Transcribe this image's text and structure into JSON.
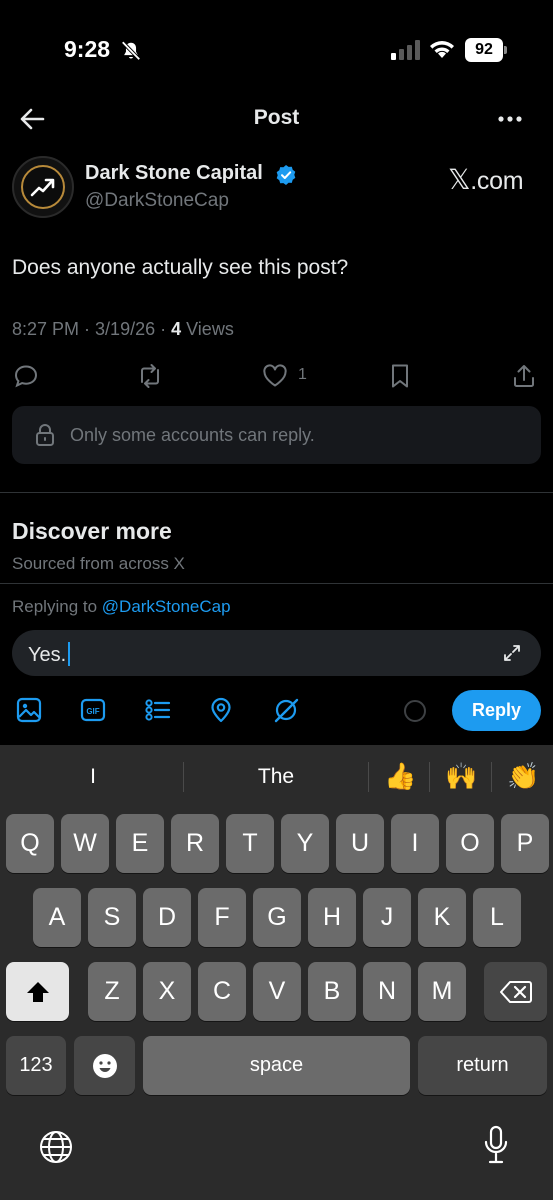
{
  "status_bar": {
    "time": "9:28",
    "battery": "92"
  },
  "header": {
    "title": "Post"
  },
  "author": {
    "name": "Dark Stone Capital",
    "handle": "@DarkStoneCap",
    "brand_x": "𝕏",
    "brand_suffix": ".com"
  },
  "post": {
    "text": "Does anyone actually see this post?",
    "time": "8:27 PM",
    "date": "3/19/26",
    "sep": " · ",
    "views_count": "4",
    "views_label": " Views",
    "like_count": "1"
  },
  "reply_restriction": "Only some accounts can reply.",
  "discover": {
    "title": "Discover more",
    "subtitle": "Sourced from across X"
  },
  "compose": {
    "replying_to_label": "Replying to ",
    "replying_to_handle": "@DarkStoneCap",
    "text": "Yes.",
    "reply_button": "Reply"
  },
  "keyboard": {
    "suggestions": [
      "I",
      "The"
    ],
    "emoji_suggestions": [
      "👍",
      "🙌",
      "👏"
    ],
    "row1": [
      "Q",
      "W",
      "E",
      "R",
      "T",
      "Y",
      "U",
      "I",
      "O",
      "P"
    ],
    "row2": [
      "A",
      "S",
      "D",
      "F",
      "G",
      "H",
      "J",
      "K",
      "L"
    ],
    "row3": [
      "Z",
      "X",
      "C",
      "V",
      "B",
      "N",
      "M"
    ],
    "numbers_key": "123",
    "space_key": "space",
    "return_key": "return"
  },
  "colors": {
    "accent": "#1d9bf0",
    "background": "#000000",
    "muted": "#71767b",
    "keyboard_bg": "#2b2b2b"
  }
}
